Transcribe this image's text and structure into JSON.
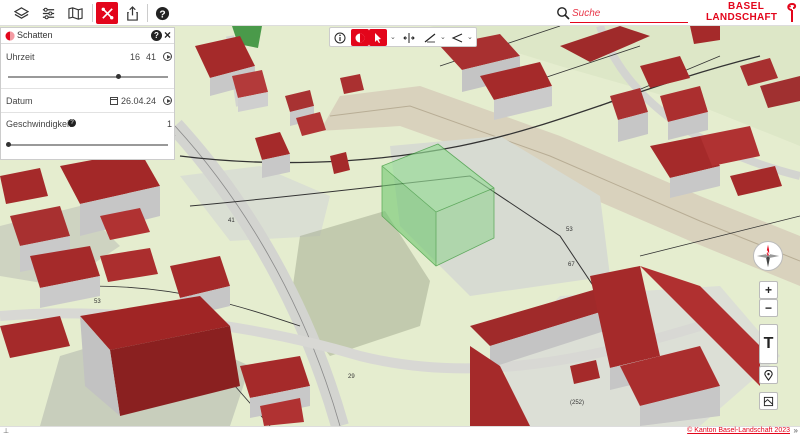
{
  "header": {
    "search_placeholder": "Suche",
    "logo_line1": "BASEL",
    "logo_line2": "LANDSCHAFT",
    "accent_color": "#e3051b",
    "icons": [
      "layers-icon",
      "filter-icon",
      "map-book-icon",
      "tools-icon",
      "share-icon",
      "help-icon",
      "search-icon"
    ]
  },
  "panel": {
    "title": "Schatten",
    "help": "?",
    "close": "×",
    "time_label": "Uhrzeit",
    "time_hour": "16",
    "time_minute": "41",
    "time_fraction": 0.69,
    "date_label": "Datum",
    "date_value": "26.04.24",
    "speed_label": "Geschwindigkeit",
    "speed_value": "1",
    "speed_fraction": 0.0
  },
  "tools": {
    "icons": [
      "info-icon",
      "shadow-icon",
      "select-pointer-icon",
      "measure-icon",
      "draw-line-icon",
      "view-angle-icon"
    ]
  },
  "map_controls": {
    "compass_n": "N",
    "zoom_in": "+",
    "zoom_out": "−",
    "tilt": "T"
  },
  "map_labels": [
    "41",
    "53",
    "67",
    "29",
    "(252)",
    "53"
  ],
  "footer": {
    "copyright": "© Kanton Basel-Landschaft 2023",
    "expand": "»"
  }
}
